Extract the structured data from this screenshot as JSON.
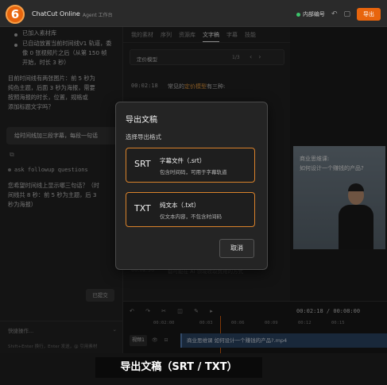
{
  "step": "6",
  "app": {
    "title": "ChatCut Online",
    "subtitle": "Agent 工作台"
  },
  "top_right": {
    "internal_label": "内部编号",
    "export_label": "导出"
  },
  "chat": {
    "bullet1": "已加入素材库",
    "bullet2": "已自动放置当前时间线V1 轨道，委",
    "bullet2b": "像 0 张视频片之后（从第 150 帧",
    "bullet2c": "开始，时长 3 秒）",
    "para1": "目前时间线有两张图片：前 5 秒为",
    "para2": "纯色主题，后面 3 秒为海报，需要",
    "para3": "按照海报的时长，位置，规格或",
    "para4": "添加标题文字吗？",
    "bubble": "给时间线加三段字幕，每段一句话",
    "followup": "ask followup questions",
    "reply1": "您希望时间线上显示哪三句话？（时",
    "reply2": "间线共 8 秒：前 5 秒为主题，后 3",
    "reply3": "秒为海报）",
    "submitted": "已提交",
    "quick_ops": "快捷操作...",
    "input_hint": "Shift+Enter 换行，Enter 发送，@ 引用素材"
  },
  "tabs": [
    "我的素材",
    "序列",
    "资源库",
    "文字稿",
    "字幕",
    "技能"
  ],
  "active_tab": 3,
  "transcript": {
    "filter_label": "定价模型",
    "page": "1/3",
    "timestamp": "00:02:18",
    "text_before": "常见的",
    "text_highlight": "定价模型",
    "text_after": "有三种:",
    "ghost1": "…",
    "ghost2": "00:02:56",
    "ghost3": "都可能在 AI 领域收取费用的方式"
  },
  "preview": {
    "caption1": "商业思维课:",
    "caption2": "如何设计一个赚钱的产品?"
  },
  "timeline": {
    "time": "00:02:18 / 00:08:00",
    "ticks": [
      "00:02:00",
      "00:03",
      "00:06",
      "00:09",
      "00:12",
      "00:15"
    ],
    "track_label": "视频1",
    "clip_label": "商业思维课  如何设计一个赚钱的产品?.mp4"
  },
  "modal": {
    "title": "导出文稿",
    "subtitle": "选择导出格式",
    "options": [
      {
        "code": "SRT",
        "title": "字幕文件（.srt）",
        "desc": "包含时间码，可用于字幕轨道"
      },
      {
        "code": "TXT",
        "title": "纯文本（.txt）",
        "desc": "仅文本内容，不包含时间码"
      }
    ],
    "cancel": "取消"
  },
  "bottom_caption": "导出文稿（SRT / TXT）",
  "colors": {
    "accent": "#e8650d",
    "option_border": "#d9822b",
    "highlight": "#f0a040"
  }
}
